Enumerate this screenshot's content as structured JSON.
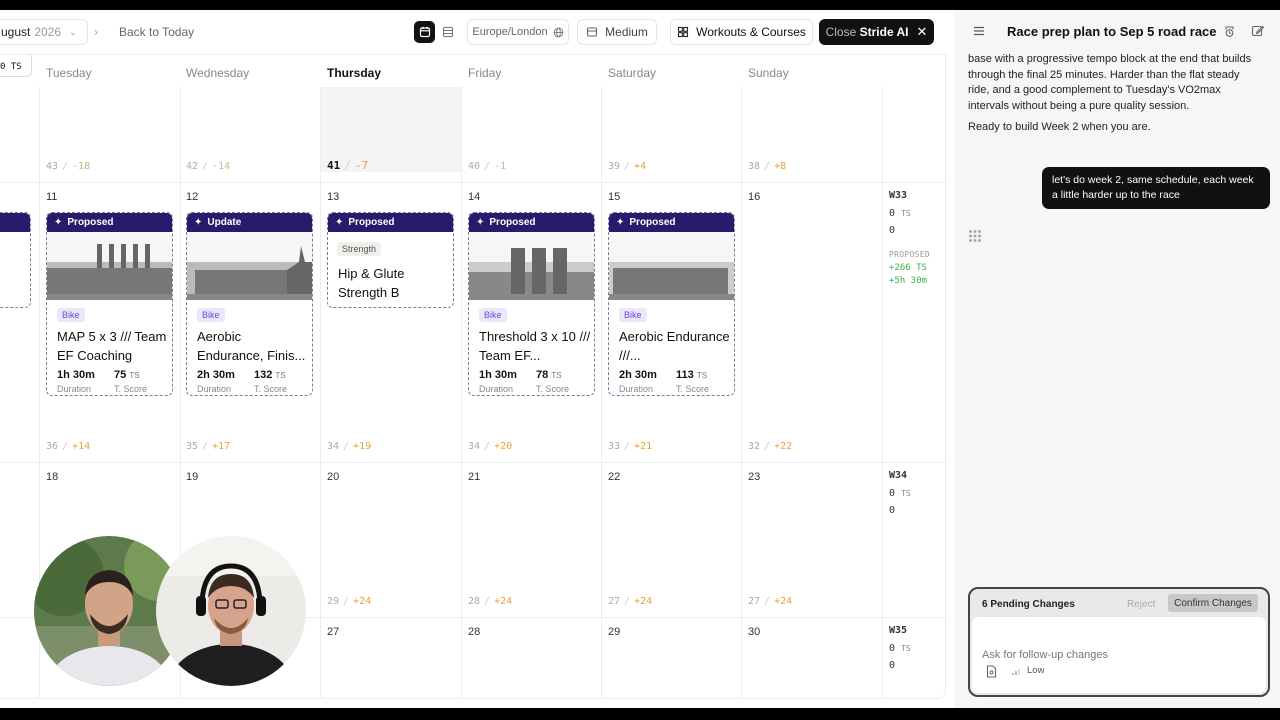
{
  "toolbar": {
    "month": "ugust",
    "year": "2026",
    "back_today": "Back to Today",
    "timezone": "Europe/London",
    "size": "Medium",
    "workouts_courses": "Workouts & Courses",
    "close_prefix": "Close",
    "close_name": "Stride AI"
  },
  "days": [
    "Tuesday",
    "Wednesday",
    "Thursday",
    "Friday",
    "Saturday",
    "Sunday"
  ],
  "week_prev": {
    "chip": "0 TS",
    "loads": [
      {
        "a": "43",
        "b": "-18"
      },
      {
        "a": "42",
        "b": "-14"
      },
      {
        "a": "41",
        "b": "-7"
      },
      {
        "a": "40",
        "b": "-1"
      },
      {
        "a": "39",
        "b": "+4"
      },
      {
        "a": "38",
        "b": "+8"
      }
    ]
  },
  "week33": {
    "dates": [
      "11",
      "12",
      "13",
      "14",
      "15",
      "16"
    ],
    "loads": [
      {
        "a": "36",
        "b": "+14"
      },
      {
        "a": "35",
        "b": "+17"
      },
      {
        "a": "34",
        "b": "+19"
      },
      {
        "a": "34",
        "b": "+20"
      },
      {
        "a": "33",
        "b": "+21"
      },
      {
        "a": "32",
        "b": "+22"
      }
    ],
    "summary": {
      "label": "W33",
      "ts": "0",
      "ts_unit": "TS",
      "other": "0",
      "proposed": "PROPOSED",
      "delta_ts": "+266 TS",
      "delta_time": "+5h 30m"
    }
  },
  "cards": [
    {
      "status": "Proposed",
      "tag": "Bike",
      "title": "MAP 5 x 3 /// Team EF Coaching",
      "duration": "1h 30m",
      "ts": "75",
      "ts_unit": "TS",
      "duration_label": "Duration",
      "score_label": "T. Score"
    },
    {
      "status": "Update",
      "tag": "Bike",
      "title": "Aerobic Endurance, Finis...",
      "duration": "2h 30m",
      "ts": "132",
      "ts_unit": "TS",
      "duration_label": "Duration",
      "score_label": "T. Score"
    },
    {
      "status": "Proposed",
      "tag": "Strength",
      "title": "Hip & Glute Strength B"
    },
    {
      "status": "Proposed",
      "tag": "Bike",
      "title": "Threshold 3 x 10 /// Team EF...",
      "duration": "1h 30m",
      "ts": "78",
      "ts_unit": "TS",
      "duration_label": "Duration",
      "score_label": "T. Score"
    },
    {
      "status": "Proposed",
      "tag": "Bike",
      "title": "Aerobic Endurance ///...",
      "duration": "2h 30m",
      "ts": "113",
      "ts_unit": "TS",
      "duration_label": "Duration",
      "score_label": "T. Score"
    }
  ],
  "week34": {
    "dates": [
      "18",
      "19",
      "20",
      "21",
      "22",
      "23"
    ],
    "loads": [
      {
        "a": "29",
        "b": "+24"
      },
      {
        "a": "28",
        "b": "+24"
      },
      {
        "a": "27",
        "b": "+24"
      },
      {
        "a": "27",
        "b": "+24"
      }
    ],
    "summary": {
      "label": "W34",
      "ts": "0",
      "ts_unit": "TS",
      "other": "0"
    }
  },
  "week35": {
    "dates": [
      "27",
      "28",
      "29",
      "30"
    ],
    "summary": {
      "label": "W35",
      "ts": "0",
      "ts_unit": "TS",
      "other": "0"
    }
  },
  "panel": {
    "title": "Race prep plan to Sep 5 road race",
    "ai_message_1": "base with a progressive tempo block at the end that builds through the final 25 minutes. Harder than the flat steady ride, and a good complement to Tuesday's VO2max intervals without being a pure quality session.",
    "ai_message_2": "Ready to build Week 2 when you are.",
    "user_message": "let's do week 2, same schedule, each week a little harder up to the race",
    "pending": "6 Pending Changes",
    "reject": "Reject",
    "confirm": "Confirm Changes",
    "input_placeholder": "Ask for follow-up changes",
    "effort": "Low"
  }
}
